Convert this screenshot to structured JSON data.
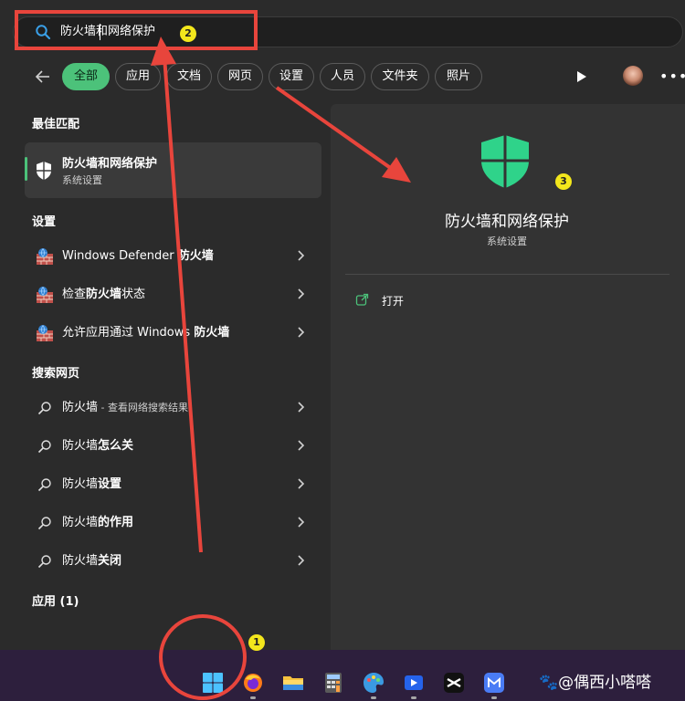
{
  "search": {
    "query": "防火墙和网络保护"
  },
  "annotations": {
    "badge1": "1",
    "badge2": "2",
    "badge3": "3"
  },
  "filters": [
    {
      "label": "全部",
      "active": true
    },
    {
      "label": "应用"
    },
    {
      "label": "文档"
    },
    {
      "label": "网页"
    },
    {
      "label": "设置"
    },
    {
      "label": "人员"
    },
    {
      "label": "文件夹"
    },
    {
      "label": "照片"
    }
  ],
  "sections": {
    "best_match": "最佳匹配",
    "settings": "设置",
    "web": "搜索网页",
    "apps": "应用 (1)"
  },
  "best_match": {
    "title": "防火墙和网络保护",
    "subtitle": "系统设置"
  },
  "settings_items": [
    {
      "label_plain": "Windows Defender ",
      "label_bold": "防火墙"
    },
    {
      "label_plain": "检查",
      "label_bold": "防火墙",
      "label_tail": "状态"
    },
    {
      "label_plain": "允许应用通过 Windows ",
      "label_bold": "防火墙"
    }
  ],
  "web_items": [
    {
      "label_plain": "防火墙",
      "label_tail": " - 查看网络搜索结果"
    },
    {
      "label_plain": "防火墙",
      "label_bold": "怎么关"
    },
    {
      "label_plain": "防火墙",
      "label_bold": "设置"
    },
    {
      "label_plain": "防火墙",
      "label_bold": "的作用"
    },
    {
      "label_plain": "防火墙",
      "label_bold": "关闭"
    }
  ],
  "detail": {
    "title": "防火墙和网络保护",
    "subtitle": "系统设置",
    "open_label": "打开"
  },
  "watermark": "@偶西小嗒嗒",
  "colors": {
    "accent": "#4cc27a",
    "annotation": "#e8453c",
    "badge": "#f3e71c"
  }
}
